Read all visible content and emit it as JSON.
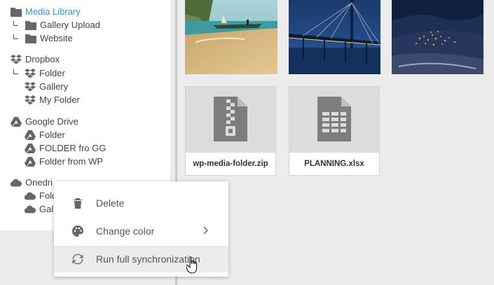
{
  "tree": {
    "media_library": "Media Library",
    "gallery_upload": "Gallery Upload",
    "website": "Website",
    "dropbox": "Dropbox",
    "dropbox_folder": "Folder",
    "dropbox_gallery": "Gallery",
    "dropbox_my_folder": "My Folder",
    "google_drive": "Google Drive",
    "gd_folder": "Folder",
    "gd_folder_fro_gg": "FOLDER fro GG",
    "gd_folder_from_wp": "Folder from WP",
    "onedrive": "Onedri",
    "od_folder": "Fold",
    "od_gallery": "Gal"
  },
  "files": {
    "zip_name": "wp-media-folder.zip",
    "xlsx_name": "PLANNING.xlsx"
  },
  "context_menu": {
    "delete": "Delete",
    "change_color": "Change color",
    "run_sync": "Run full synchronization"
  },
  "colors": {
    "active_link": "#3a8ed6",
    "icon_gray": "#666666",
    "menu_hover": "#ebebeb"
  }
}
